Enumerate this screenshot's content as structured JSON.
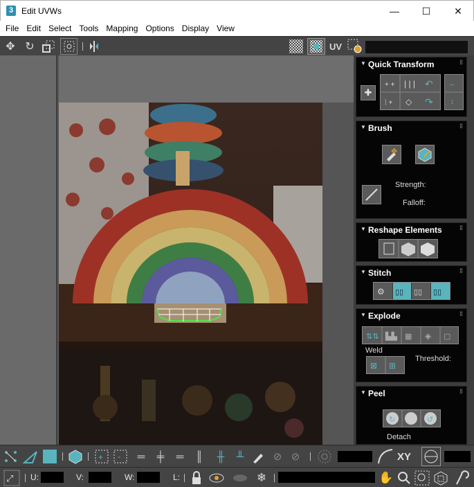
{
  "window": {
    "app_icon_text": "3",
    "title": "Edit UVWs",
    "minimize": "—",
    "maximize": "☐",
    "close": "✕"
  },
  "menu": [
    "File",
    "Edit",
    "Select",
    "Tools",
    "Mapping",
    "Options",
    "Display",
    "View"
  ],
  "toolbar": {
    "uv_label": "UV",
    "icons": [
      "move-icon",
      "rotate-icon",
      "scale-icon",
      "freeform-icon",
      "mirror-icon",
      "checker-icon",
      "texture-icon",
      "uv-switch-icon",
      "settings-icon"
    ]
  },
  "panel": {
    "quick_transform": {
      "title": "Quick Transform"
    },
    "brush": {
      "title": "Brush",
      "strength_label": "Strength:",
      "falloff_label": "Falloff:"
    },
    "reshape": {
      "title": "Reshape Elements"
    },
    "stitch": {
      "title": "Stitch"
    },
    "explode": {
      "title": "Explode",
      "weld_label": "Weld",
      "threshold_label": "Threshold:"
    },
    "peel": {
      "title": "Peel",
      "detach_label": "Detach"
    }
  },
  "bottom": {
    "xy_label": "XY",
    "u_label": "U:",
    "v_label": "V:",
    "w_label": "W:",
    "l_label": "L:"
  },
  "colors": {
    "accent": "#59b4bd",
    "panel_bg": "#050505",
    "toolbar_bg": "#444444"
  }
}
